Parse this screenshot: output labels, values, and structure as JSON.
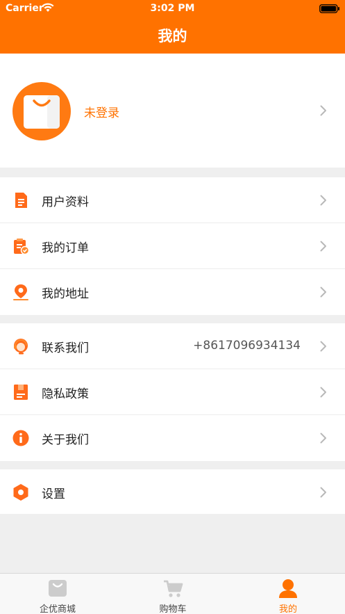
{
  "status_bar": {
    "carrier": "Carrier",
    "time": "3:02 PM"
  },
  "nav": {
    "title": "我的"
  },
  "profile": {
    "login_text": "未登录"
  },
  "menu_group_1": [
    {
      "label": "用户资料",
      "icon": "profile-document-icon"
    },
    {
      "label": "我的订单",
      "icon": "order-clipboard-icon"
    },
    {
      "label": "我的地址",
      "icon": "location-pin-icon"
    }
  ],
  "menu_group_2": [
    {
      "label": "联系我们",
      "value": "+8617096934134",
      "icon": "customer-service-icon"
    },
    {
      "label": "隐私政策",
      "icon": "privacy-document-icon"
    },
    {
      "label": "关于我们",
      "icon": "info-icon"
    }
  ],
  "menu_group_3": [
    {
      "label": "设置",
      "icon": "settings-hexagon-icon"
    }
  ],
  "tabbar": [
    {
      "label": "企优商城",
      "icon": "shop-bag-icon",
      "active": false
    },
    {
      "label": "购物车",
      "icon": "cart-icon",
      "active": false
    },
    {
      "label": "我的",
      "icon": "user-icon",
      "active": true
    }
  ],
  "colors": {
    "accent": "#ff7200",
    "background": "#efefef",
    "inactive_icon": "#cccccc"
  }
}
